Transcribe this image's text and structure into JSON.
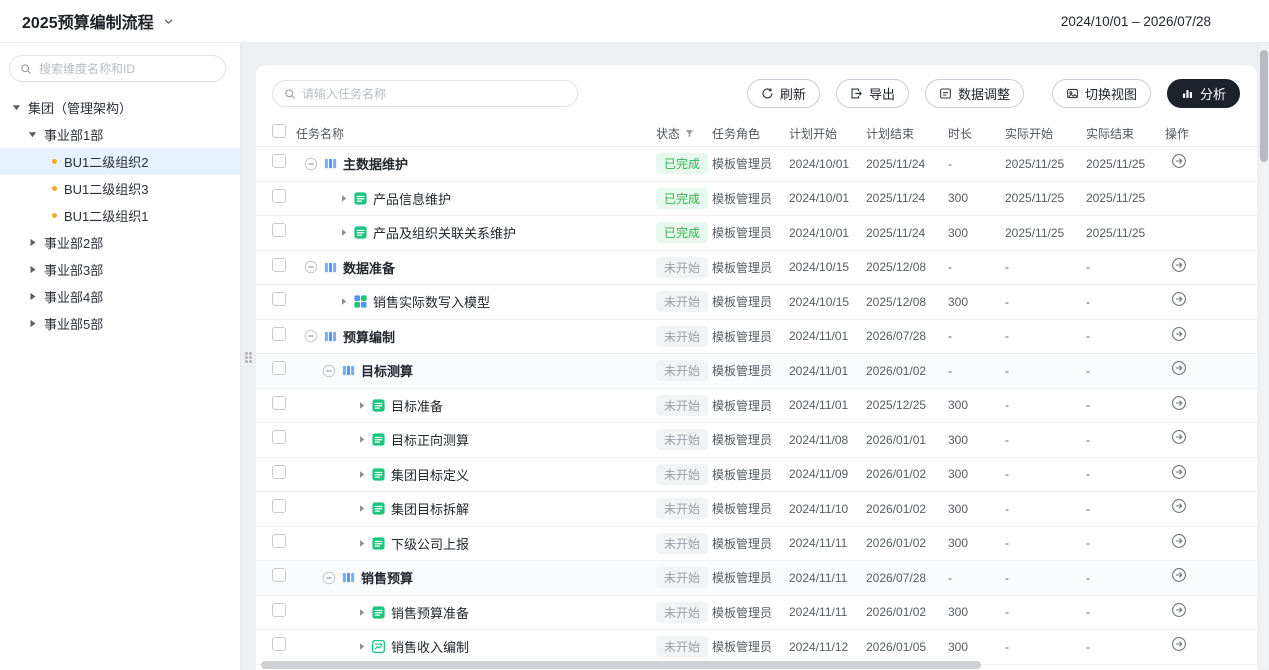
{
  "header": {
    "title": "2025预算编制流程",
    "date_range": "2024/10/01 – 2026/07/28"
  },
  "sidebar": {
    "search_placeholder": "搜索维度名称和ID",
    "tree": [
      {
        "label": "集团（管理架构）",
        "level": 0,
        "type": "expanded"
      },
      {
        "label": "事业部1部",
        "level": 1,
        "type": "expanded"
      },
      {
        "label": "BU1二级组织2",
        "level": 2,
        "type": "leaf",
        "selected": true
      },
      {
        "label": "BU1二级组织3",
        "level": 2,
        "type": "leaf"
      },
      {
        "label": "BU1二级组织1",
        "level": 2,
        "type": "leaf"
      },
      {
        "label": "事业部2部",
        "level": 1,
        "type": "collapsed"
      },
      {
        "label": "事业部3部",
        "level": 1,
        "type": "collapsed"
      },
      {
        "label": "事业部4部",
        "level": 1,
        "type": "collapsed"
      },
      {
        "label": "事业部5部",
        "level": 1,
        "type": "collapsed"
      }
    ]
  },
  "toolbar": {
    "search_placeholder": "请输入任务名称",
    "buttons": [
      {
        "label": "刷新",
        "icon": "refresh-icon"
      },
      {
        "label": "导出",
        "icon": "export-icon"
      },
      {
        "label": "数据调整",
        "icon": "data-adjust-icon"
      },
      {
        "label": "切换视图",
        "icon": "switch-view-icon"
      },
      {
        "label": "分析",
        "icon": "analysis-icon",
        "primary": true
      }
    ]
  },
  "table": {
    "columns": [
      {
        "label": "任务名称"
      },
      {
        "label": "状态",
        "filter": true
      },
      {
        "label": "任务角色"
      },
      {
        "label": "计划开始"
      },
      {
        "label": "计划结束"
      },
      {
        "label": "时长"
      },
      {
        "label": "实际开始"
      },
      {
        "label": "实际结束"
      },
      {
        "label": "操作"
      }
    ],
    "rows": [
      {
        "name": "主数据维护",
        "level": 0,
        "node": "group",
        "icon": "group-bars-icon",
        "status": "已完成",
        "status_kind": "done",
        "role": "模板管理员",
        "plan_start": "2024/10/01",
        "plan_end": "2025/11/24",
        "duration": "-",
        "actual_start": "2025/11/25",
        "actual_end": "2025/11/25",
        "action": true
      },
      {
        "name": "产品信息维护",
        "level": 1,
        "node": "leaf",
        "icon": "form-icon",
        "status": "已完成",
        "status_kind": "done",
        "role": "模板管理员",
        "plan_start": "2024/10/01",
        "plan_end": "2025/11/24",
        "duration": "300",
        "actual_start": "2025/11/25",
        "actual_end": "2025/11/25",
        "action": false
      },
      {
        "name": "产品及组织关联关系维护",
        "level": 1,
        "node": "leaf",
        "icon": "form-icon",
        "status": "已完成",
        "status_kind": "done",
        "role": "模板管理员",
        "plan_start": "2024/10/01",
        "plan_end": "2025/11/24",
        "duration": "300",
        "actual_start": "2025/11/25",
        "actual_end": "2025/11/25",
        "action": false
      },
      {
        "name": "数据准备",
        "level": 0,
        "node": "group",
        "icon": "group-bars-icon",
        "status": "未开始",
        "status_kind": "pending",
        "role": "模板管理员",
        "plan_start": "2024/10/15",
        "plan_end": "2025/12/08",
        "duration": "-",
        "actual_start": "-",
        "actual_end": "-",
        "action": true
      },
      {
        "name": "销售实际数写入模型",
        "level": 1,
        "node": "leaf",
        "icon": "model-icon",
        "status": "未开始",
        "status_kind": "pending",
        "role": "模板管理员",
        "plan_start": "2024/10/15",
        "plan_end": "2025/12/08",
        "duration": "300",
        "actual_start": "-",
        "actual_end": "-",
        "action": true
      },
      {
        "name": "预算编制",
        "level": 0,
        "node": "group",
        "icon": "group-bars-icon",
        "status": "未开始",
        "status_kind": "pending",
        "role": "模板管理员",
        "plan_start": "2024/11/01",
        "plan_end": "2026/07/28",
        "duration": "-",
        "actual_start": "-",
        "actual_end": "-",
        "action": true
      },
      {
        "name": "目标测算",
        "level": 1,
        "node": "group",
        "icon": "group-bars-icon",
        "status": "未开始",
        "status_kind": "pending",
        "role": "模板管理员",
        "plan_start": "2024/11/01",
        "plan_end": "2026/01/02",
        "duration": "-",
        "actual_start": "-",
        "actual_end": "-",
        "action": true,
        "shaded": true
      },
      {
        "name": "目标准备",
        "level": 2,
        "node": "leaf",
        "icon": "form-icon",
        "status": "未开始",
        "status_kind": "pending",
        "role": "模板管理员",
        "plan_start": "2024/11/01",
        "plan_end": "2025/12/25",
        "duration": "300",
        "actual_start": "-",
        "actual_end": "-",
        "action": true
      },
      {
        "name": "目标正向测算",
        "level": 2,
        "node": "leaf",
        "icon": "form-icon",
        "status": "未开始",
        "status_kind": "pending",
        "role": "模板管理员",
        "plan_start": "2024/11/08",
        "plan_end": "2026/01/01",
        "duration": "300",
        "actual_start": "-",
        "actual_end": "-",
        "action": true
      },
      {
        "name": "集团目标定义",
        "level": 2,
        "node": "leaf",
        "icon": "form-icon",
        "status": "未开始",
        "status_kind": "pending",
        "role": "模板管理员",
        "plan_start": "2024/11/09",
        "plan_end": "2026/01/02",
        "duration": "300",
        "actual_start": "-",
        "actual_end": "-",
        "action": true
      },
      {
        "name": "集团目标拆解",
        "level": 2,
        "node": "leaf",
        "icon": "form-icon",
        "status": "未开始",
        "status_kind": "pending",
        "role": "模板管理员",
        "plan_start": "2024/11/10",
        "plan_end": "2026/01/02",
        "duration": "300",
        "actual_start": "-",
        "actual_end": "-",
        "action": true
      },
      {
        "name": "下级公司上报",
        "level": 2,
        "node": "leaf",
        "icon": "form-icon",
        "status": "未开始",
        "status_kind": "pending",
        "role": "模板管理员",
        "plan_start": "2024/11/11",
        "plan_end": "2026/01/02",
        "duration": "300",
        "actual_start": "-",
        "actual_end": "-",
        "action": true
      },
      {
        "name": "销售预算",
        "level": 1,
        "node": "group",
        "icon": "group-bars-icon",
        "status": "未开始",
        "status_kind": "pending",
        "role": "模板管理员",
        "plan_start": "2024/11/11",
        "plan_end": "2026/07/28",
        "duration": "-",
        "actual_start": "-",
        "actual_end": "-",
        "action": true,
        "shaded": true
      },
      {
        "name": "销售预算准备",
        "level": 2,
        "node": "leaf",
        "icon": "form-icon",
        "status": "未开始",
        "status_kind": "pending",
        "role": "模板管理员",
        "plan_start": "2024/11/11",
        "plan_end": "2026/01/02",
        "duration": "300",
        "actual_start": "-",
        "actual_end": "-",
        "action": true
      },
      {
        "name": "销售收入编制",
        "level": 2,
        "node": "leaf",
        "icon": "sheet-icon",
        "status": "未开始",
        "status_kind": "pending",
        "role": "模板管理员",
        "plan_start": "2024/11/12",
        "plan_end": "2026/01/05",
        "duration": "300",
        "actual_start": "-",
        "actual_end": "-",
        "action": true
      }
    ]
  }
}
